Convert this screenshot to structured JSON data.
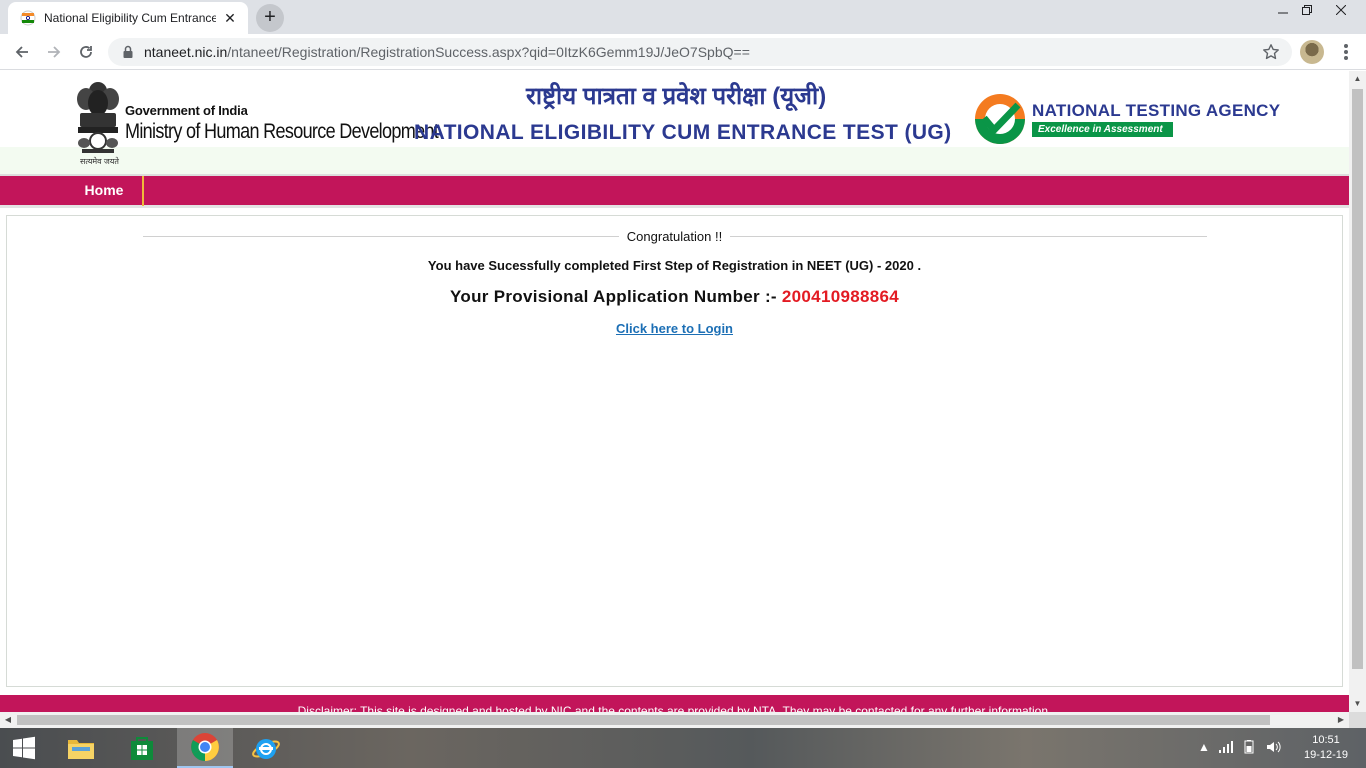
{
  "browser": {
    "tab_title": "National Eligibility Cum Entrance",
    "new_tab_symbol": "+",
    "close_symbol": "✕",
    "url_domain": "ntaneet.nic.in",
    "url_path": "/ntaneet/Registration/RegistrationSuccess.aspx?qid=0ItzK6Gemm19J/JeO7SpbQ=="
  },
  "header": {
    "gov_line": "Government of India",
    "ministry": "Ministry of Human Resource Development",
    "motto": "सत्यमेव जयते",
    "hindi_title": "राष्ट्रीय पात्रता व प्रवेश परीक्षा (यूजी)",
    "english_title": "NATIONAL ELIGIBILITY CUM ENTRANCE TEST (UG)",
    "agency_name": "NATIONAL TESTING AGENCY",
    "agency_tagline": "Excellence in Assessment"
  },
  "menu": {
    "home": "Home"
  },
  "content": {
    "legend": "Congratulation !!",
    "success_message": "You have Sucessfully completed First Step of Registration in NEET (UG) - 2020 .",
    "app_number_label": "Your Provisional Application Number :-",
    "app_number": "200410988864",
    "login_link": "Click here to Login"
  },
  "footer": {
    "disclaimer": "Disclaimer: This site is designed and hosted by NIC and the contents are provided by NTA. They may be contacted for any further information."
  },
  "taskbar": {
    "time": "10:51",
    "date": "19-12-19"
  },
  "colors": {
    "brand_crimson": "#c2155a",
    "title_blue": "#2b3990",
    "app_number_red": "#e31b23",
    "link_blue": "#1c6fb5",
    "nta_green": "#0a9547"
  }
}
